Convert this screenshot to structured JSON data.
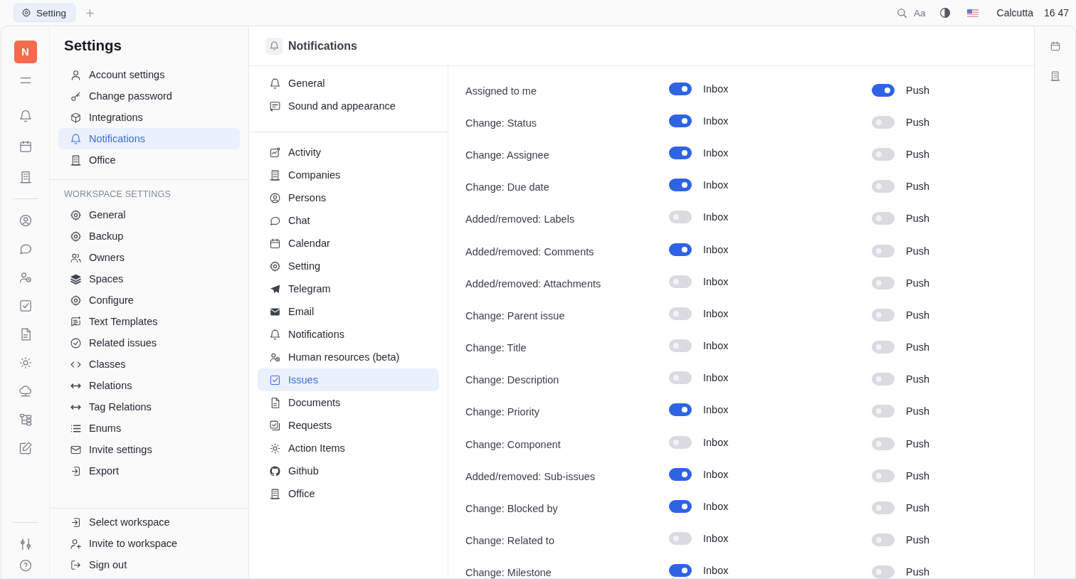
{
  "tab": {
    "label": "Setting",
    "selected": true
  },
  "topbar": {
    "font_button": "Aa",
    "location": "Calcutta",
    "time": "16 47"
  },
  "rail": {
    "avatar": "N"
  },
  "settings": {
    "title": "Settings",
    "items": [
      {
        "label": "Account settings",
        "selected": false
      },
      {
        "label": "Change password",
        "selected": false
      },
      {
        "label": "Integrations",
        "selected": false
      },
      {
        "label": "Notifications",
        "selected": true
      },
      {
        "label": "Office",
        "selected": false
      }
    ],
    "workspace_heading": "WORKSPACE SETTINGS",
    "workspace_items": [
      {
        "label": "General",
        "selected": false
      },
      {
        "label": "Backup",
        "selected": false
      },
      {
        "label": "Owners",
        "selected": false
      },
      {
        "label": "Spaces",
        "selected": false
      },
      {
        "label": "Configure",
        "selected": false
      },
      {
        "label": "Text Templates",
        "selected": false
      },
      {
        "label": "Related issues",
        "selected": false
      },
      {
        "label": "Classes",
        "selected": false
      },
      {
        "label": "Relations",
        "selected": false
      },
      {
        "label": "Tag Relations",
        "selected": false
      },
      {
        "label": "Enums",
        "selected": false
      },
      {
        "label": "Invite settings",
        "selected": false
      },
      {
        "label": "Export",
        "selected": false
      }
    ],
    "footer_items": [
      {
        "label": "Select workspace",
        "selected": false
      },
      {
        "label": "Invite to workspace",
        "selected": false
      },
      {
        "label": "Sign out",
        "selected": false
      }
    ]
  },
  "notifications": {
    "title": "Notifications",
    "groups": [
      [
        {
          "label": "General",
          "selected": false
        },
        {
          "label": "Sound and appearance",
          "selected": false
        }
      ],
      [
        {
          "label": "Activity",
          "selected": false
        },
        {
          "label": "Companies",
          "selected": false
        },
        {
          "label": "Persons",
          "selected": false
        },
        {
          "label": "Chat",
          "selected": false
        },
        {
          "label": "Calendar",
          "selected": false
        },
        {
          "label": "Setting",
          "selected": false
        },
        {
          "label": "Telegram",
          "selected": false
        },
        {
          "label": "Email",
          "selected": false
        },
        {
          "label": "Notifications",
          "selected": false
        },
        {
          "label": "Human resources (beta)",
          "selected": false
        },
        {
          "label": "Issues",
          "selected": true
        },
        {
          "label": "Documents",
          "selected": false
        },
        {
          "label": "Requests",
          "selected": false
        },
        {
          "label": "Action Items",
          "selected": false
        },
        {
          "label": "Github",
          "selected": false
        },
        {
          "label": "Office",
          "selected": false
        }
      ]
    ],
    "rows": [
      {
        "label": "Assigned to me",
        "inbox": {
          "label": "Inbox",
          "on": true
        },
        "push": {
          "label": "Push",
          "on": true
        }
      },
      {
        "label": "Change: Status",
        "inbox": {
          "label": "Inbox",
          "on": true
        },
        "push": {
          "label": "Push",
          "on": false
        }
      },
      {
        "label": "Change: Assignee",
        "inbox": {
          "label": "Inbox",
          "on": true
        },
        "push": {
          "label": "Push",
          "on": false
        }
      },
      {
        "label": "Change: Due date",
        "inbox": {
          "label": "Inbox",
          "on": true
        },
        "push": {
          "label": "Push",
          "on": false
        }
      },
      {
        "label": "Added/removed: Labels",
        "inbox": {
          "label": "Inbox",
          "on": false
        },
        "push": {
          "label": "Push",
          "on": false
        }
      },
      {
        "label": "Added/removed: Comments",
        "inbox": {
          "label": "Inbox",
          "on": true
        },
        "push": {
          "label": "Push",
          "on": false
        }
      },
      {
        "label": "Added/removed: Attachments",
        "inbox": {
          "label": "Inbox",
          "on": false
        },
        "push": {
          "label": "Push",
          "on": false
        }
      },
      {
        "label": "Change: Parent issue",
        "inbox": {
          "label": "Inbox",
          "on": false
        },
        "push": {
          "label": "Push",
          "on": false
        }
      },
      {
        "label": "Change: Title",
        "inbox": {
          "label": "Inbox",
          "on": false
        },
        "push": {
          "label": "Push",
          "on": false
        }
      },
      {
        "label": "Change: Description",
        "inbox": {
          "label": "Inbox",
          "on": false
        },
        "push": {
          "label": "Push",
          "on": false
        }
      },
      {
        "label": "Change: Priority",
        "inbox": {
          "label": "Inbox",
          "on": true
        },
        "push": {
          "label": "Push",
          "on": false
        }
      },
      {
        "label": "Change: Component",
        "inbox": {
          "label": "Inbox",
          "on": false
        },
        "push": {
          "label": "Push",
          "on": false
        }
      },
      {
        "label": "Added/removed: Sub-issues",
        "inbox": {
          "label": "Inbox",
          "on": true
        },
        "push": {
          "label": "Push",
          "on": false
        }
      },
      {
        "label": "Change: Blocked by",
        "inbox": {
          "label": "Inbox",
          "on": true
        },
        "push": {
          "label": "Push",
          "on": false
        }
      },
      {
        "label": "Change: Related to",
        "inbox": {
          "label": "Inbox",
          "on": false
        },
        "push": {
          "label": "Push",
          "on": false
        }
      },
      {
        "label": "Change: Milestone",
        "inbox": {
          "label": "Inbox",
          "on": true
        },
        "push": {
          "label": "Push",
          "on": false
        }
      }
    ]
  }
}
